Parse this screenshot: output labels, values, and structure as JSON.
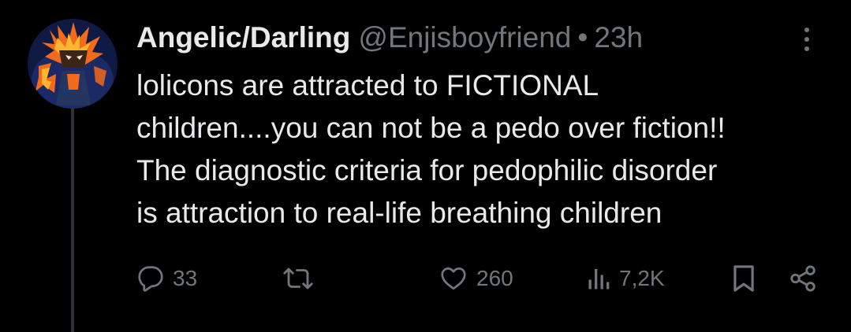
{
  "tweet": {
    "display_name": "Angelic/Darling",
    "handle": "@Enjisboyfriend",
    "separator": "•",
    "time": "23h",
    "text_lines": [
      "lolicons are attracted to FICTIONAL",
      "children....you can not be a pedo over fiction!!",
      "The diagnostic criteria for pedophilic disorder",
      "is attraction to real-life breathing children"
    ]
  },
  "actions": {
    "replies": "33",
    "likes": "260",
    "views": "7,2K"
  },
  "icons": {
    "more": "more-vertical-icon",
    "reply": "reply-icon",
    "repost": "repost-icon",
    "like": "heart-icon",
    "views": "views-chart-icon",
    "bookmark": "bookmark-icon",
    "share": "share-icon"
  },
  "colors": {
    "background": "#000000",
    "primary_text": "#e7e9ea",
    "secondary_text": "#71767b",
    "thread_line": "#2f3336"
  }
}
